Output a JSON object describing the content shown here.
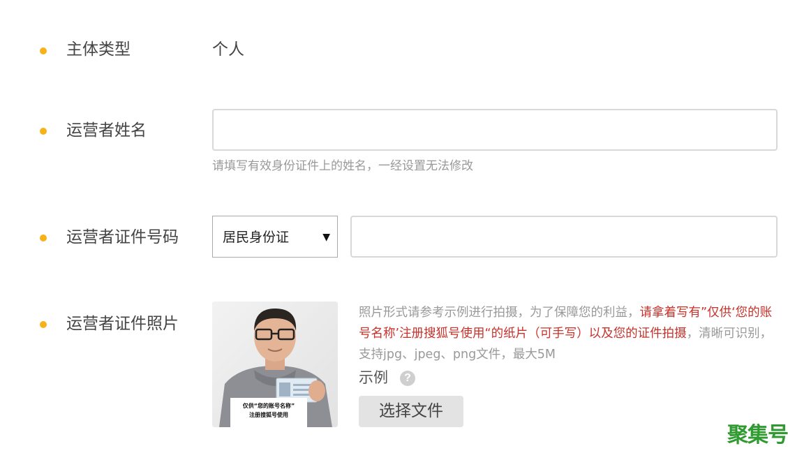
{
  "colors": {
    "bullet": "#f7b21a",
    "hint_red": "#c8322a",
    "watermark_green": "#2f9a2f"
  },
  "subject_type": {
    "label": "主体类型",
    "value": "个人"
  },
  "operator_name": {
    "label": "运营者姓名",
    "value": "",
    "hint": "请填写有效身份证件上的姓名，一经设置无法修改"
  },
  "operator_id_number": {
    "label": "运营者证件号码",
    "id_type_selected": "居民身份证",
    "dropdown_arrow": "▼",
    "value": ""
  },
  "operator_id_photo": {
    "label": "运营者证件照片",
    "sample_photo_sign": [
      "仅供“您的账号名称”",
      "注册搜狐号使用"
    ],
    "description": {
      "part1": "照片形式请参考示例进行拍摄，为了保障您的利益，",
      "part2_red": "请拿着写有”仅供‘您的账号名称’注册搜狐号使用“的纸片（可手写）以及您的证件拍摄",
      "part3": "，清晰可识别，支持jpg、jpeg、png文件，最大5M"
    },
    "example_label": "示例",
    "help_icon": "question-mark-icon",
    "help_glyph": "?",
    "choose_file_label": "选择文件"
  },
  "watermark": {
    "text": "聚集号"
  }
}
